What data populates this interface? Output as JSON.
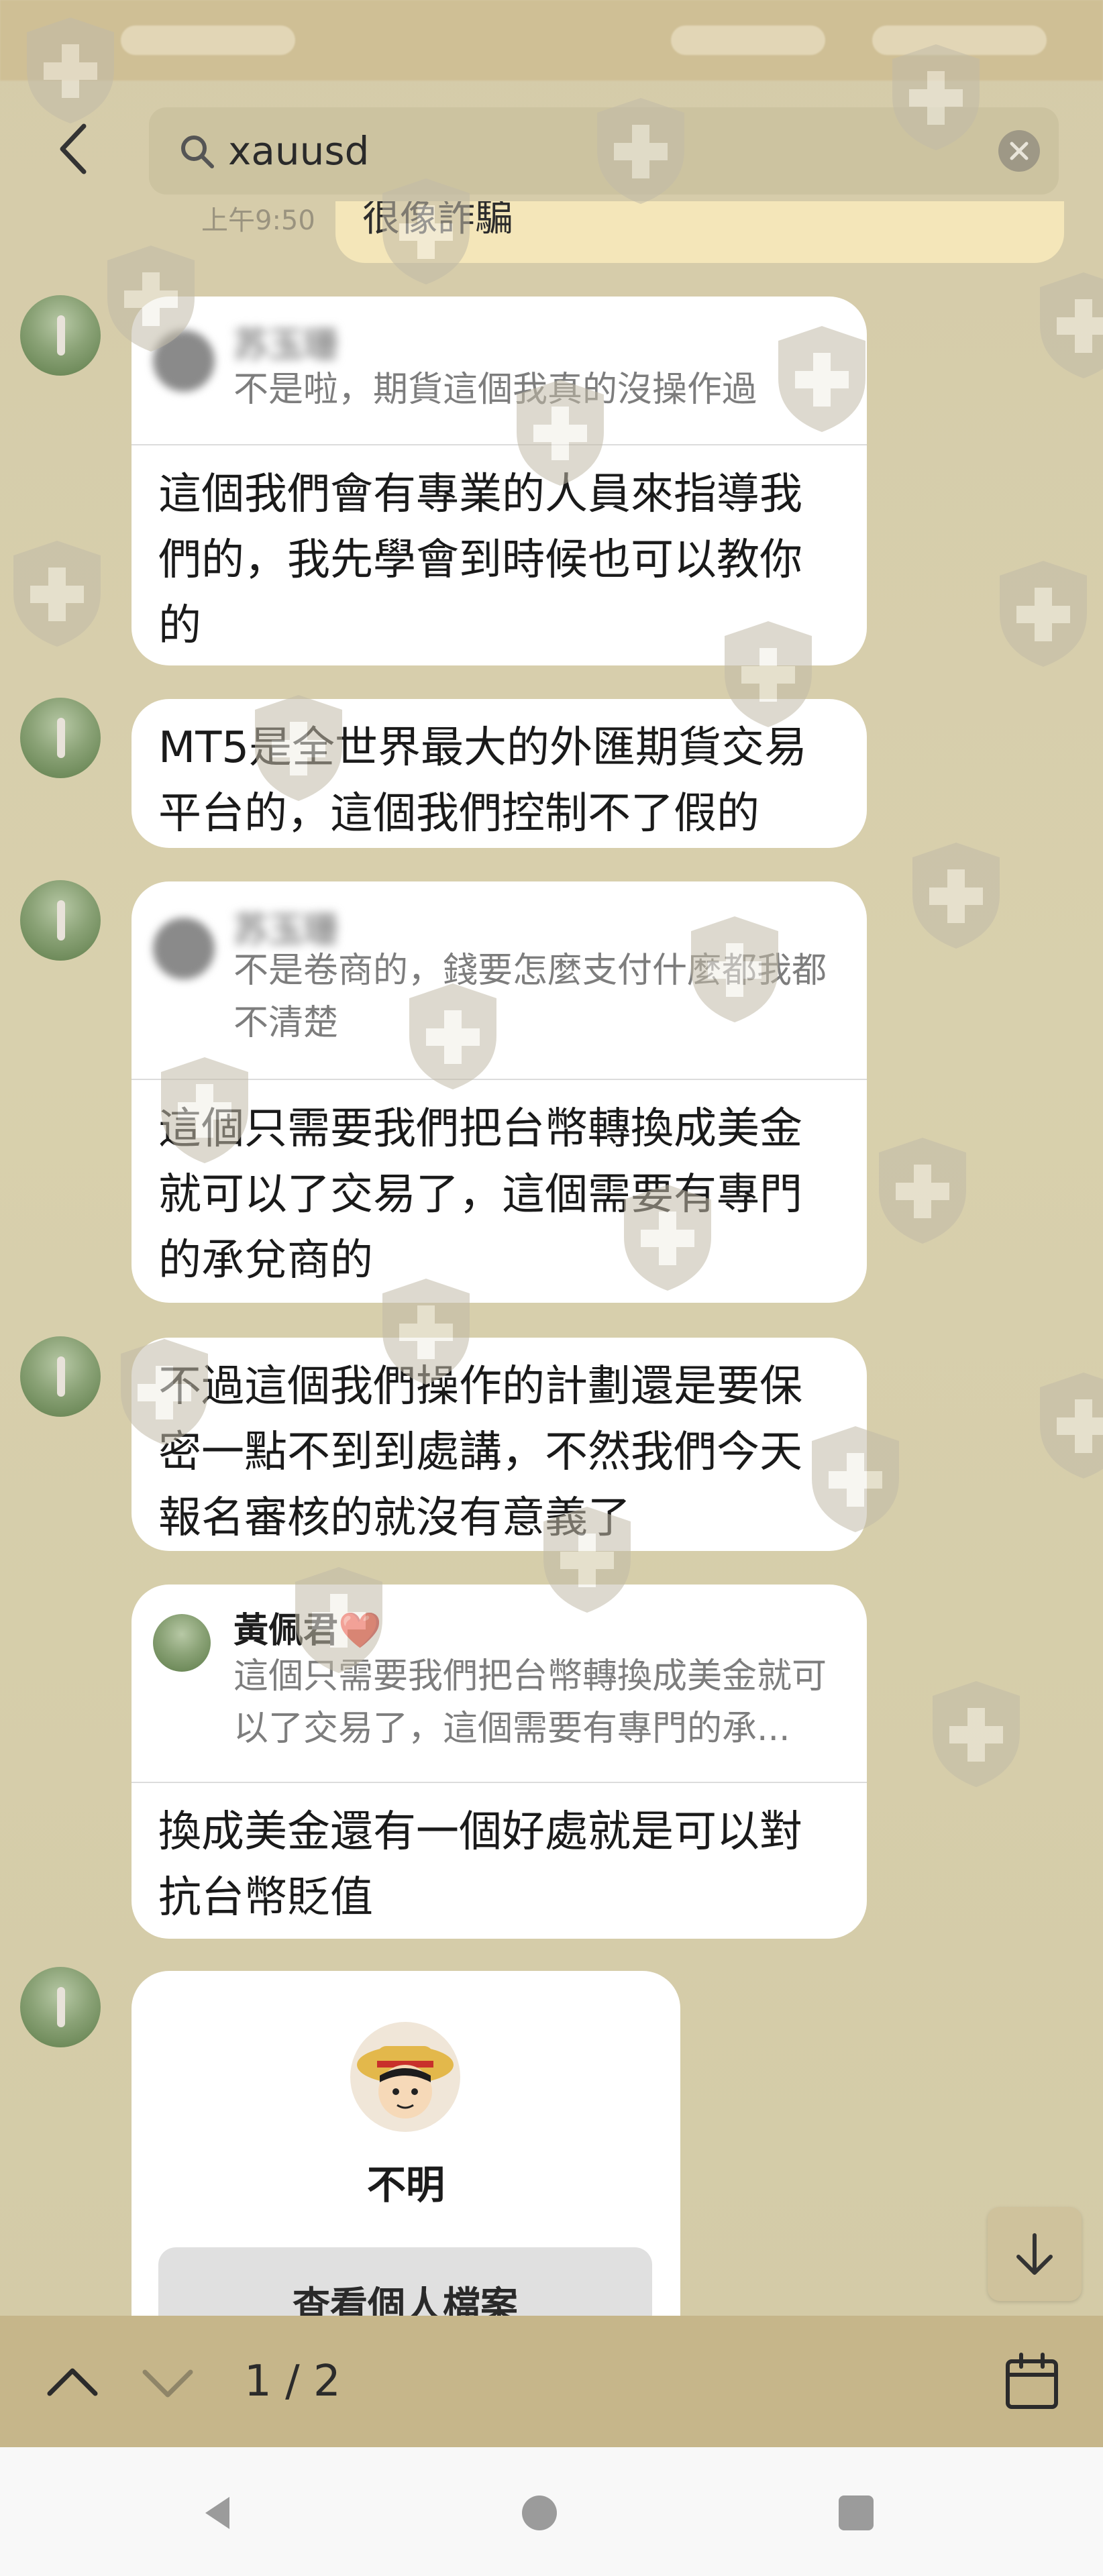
{
  "search": {
    "query": "xauusd"
  },
  "previous": {
    "time": "上午9:50",
    "text": "很像詐騙"
  },
  "messages": [
    {
      "quote_name": "苏玉珊",
      "quote_text": "不是啦，期貨這個我真的沒操作過",
      "text": "這個我們會有專業的人員來指導我們的，我先學會到時候也可以教你的"
    },
    {
      "text": "MT5是全世界最大的外匯期貨交易平台的，這個我們控制不了假的"
    },
    {
      "quote_name": "苏玉珊",
      "quote_text": "不是卷商的，錢要怎麼支付什麼都我都不清楚",
      "text": "這個只需要我們把台幣轉換成美金就可以了交易了，這個需要有專門的承兌商的"
    },
    {
      "text": "不過這個我們操作的計劃還是要保密一點不到到處講，不然我們今天報名審核的就沒有意義了"
    },
    {
      "quote_name": "黃佩君❤️",
      "quote_text": "這個只需要我們把台幣轉換成美金就可以了交易了，這個需要有專門的承...",
      "text": "換成美金還有一個好處就是可以對抗台幣貶值"
    }
  ],
  "contact_card": {
    "name": "不明",
    "button": "查看個人檔案"
  },
  "find": {
    "count": "1 / 2"
  },
  "icons": {
    "back": "chevron-left-icon",
    "search": "search-icon",
    "clear": "clear-icon",
    "scroll": "arrow-down-icon",
    "up": "chevron-up-icon",
    "down": "chevron-down-icon",
    "calendar": "calendar-icon",
    "nav": [
      "nav-back-icon",
      "nav-home-icon",
      "nav-recents-icon"
    ]
  },
  "colors": {
    "bubble": "#ffffff",
    "background": "#d7cfae",
    "findbar": "#c6b68a",
    "highlight": "#f4e6b9"
  }
}
